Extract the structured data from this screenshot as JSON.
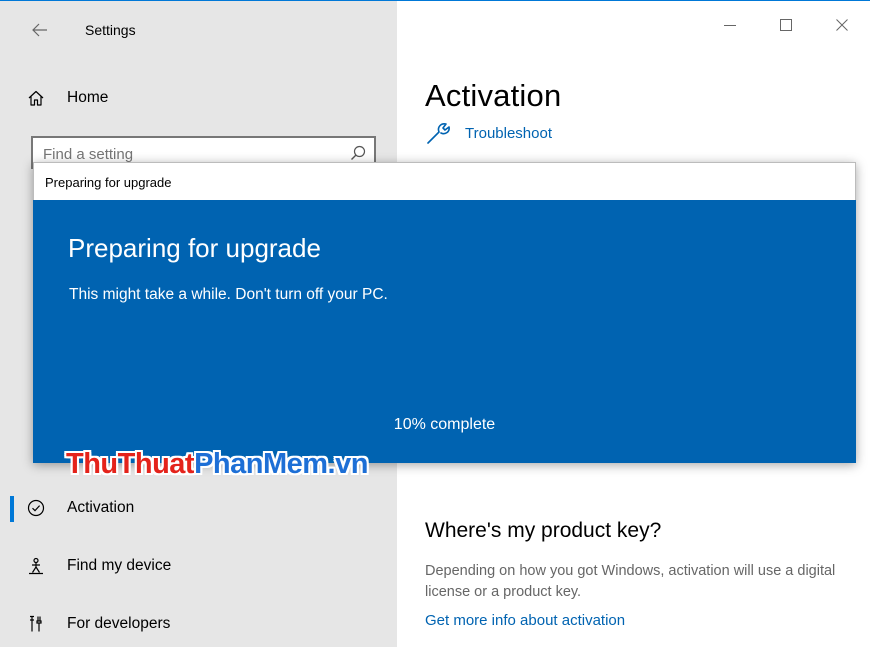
{
  "window": {
    "app_title": "Settings",
    "accent_color": "#0078d7"
  },
  "sidebar": {
    "home_label": "Home",
    "search": {
      "placeholder": "Find a setting",
      "value": ""
    },
    "items": [
      {
        "label": "Activation",
        "icon": "circle-check-icon",
        "active": true
      },
      {
        "label": "Find my device",
        "icon": "person-location-icon",
        "active": false
      },
      {
        "label": "For developers",
        "icon": "developer-tools-icon",
        "active": false
      }
    ]
  },
  "main": {
    "page_title": "Activation",
    "troubleshoot_label": "Troubleshoot",
    "product_key": {
      "heading": "Where's my product key?",
      "description": "Depending on how you got Windows, activation will use a digital license or a product key.",
      "link": "Get more info about activation"
    }
  },
  "dialog": {
    "title_bar": "Preparing for upgrade",
    "heading": "Preparing for upgrade",
    "message": "This might take a while. Don't turn off your PC.",
    "progress_text": "10% complete",
    "progress_value": 10,
    "background_color": "#0063b1"
  },
  "watermark": {
    "part1": "ThuThuat",
    "part2": "PhanMem.vn",
    "color1": "#e4231b",
    "color2": "#1d6fd6"
  }
}
